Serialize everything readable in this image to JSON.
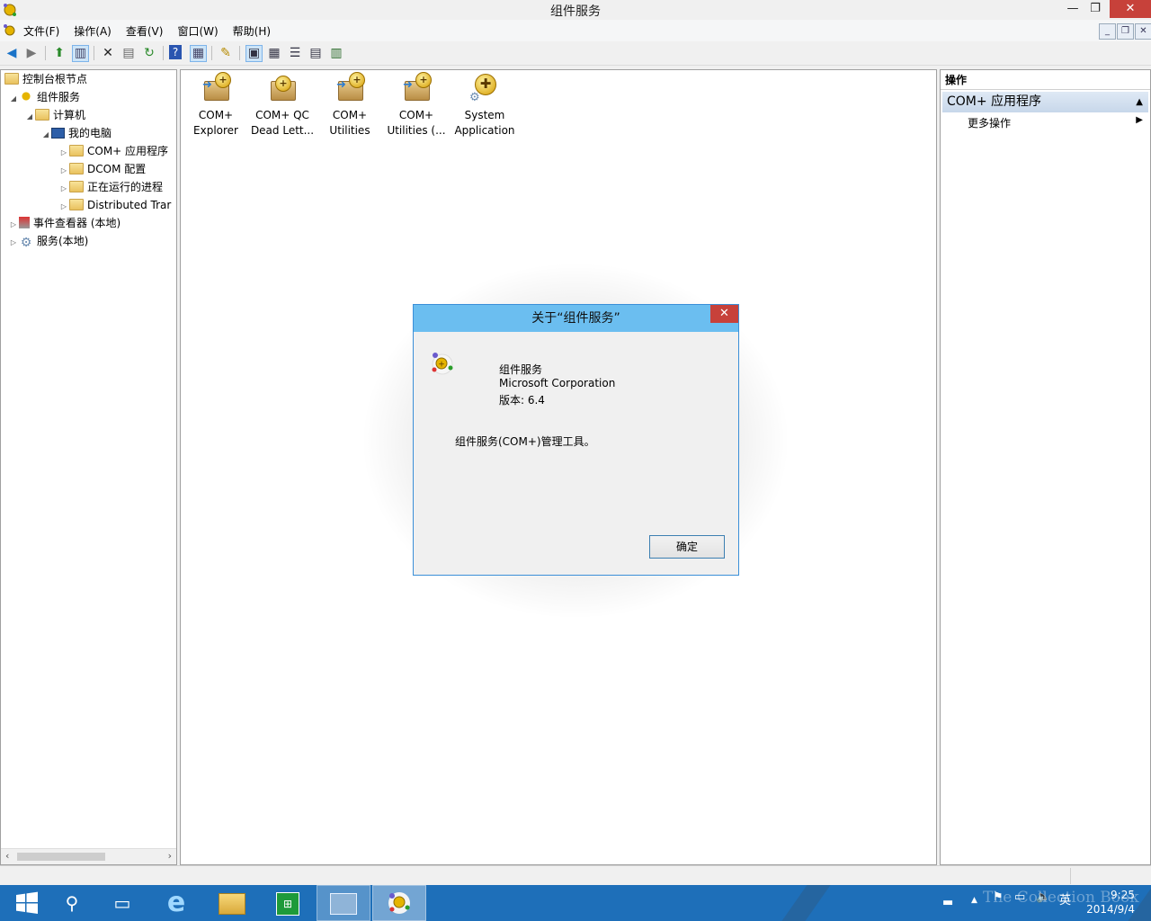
{
  "window": {
    "title": "组件服务",
    "minimize": "—",
    "maximize": "❐",
    "close": "✕"
  },
  "menu": {
    "items": [
      "文件(F)",
      "操作(A)",
      "查看(V)",
      "窗口(W)",
      "帮助(H)"
    ]
  },
  "tree": {
    "items": [
      {
        "label": "控制台根节点"
      },
      {
        "label": "组件服务"
      },
      {
        "label": "计算机"
      },
      {
        "label": "我的电脑"
      },
      {
        "label": "COM+ 应用程序"
      },
      {
        "label": "DCOM 配置"
      },
      {
        "label": "正在运行的进程"
      },
      {
        "label": "Distributed Trar"
      },
      {
        "label": "事件查看器 (本地)"
      },
      {
        "label": "服务(本地)"
      }
    ]
  },
  "center": {
    "items": [
      {
        "line1": "COM+",
        "line2": "Explorer"
      },
      {
        "line1": "COM+ QC",
        "line2": "Dead Lett..."
      },
      {
        "line1": "COM+",
        "line2": "Utilities"
      },
      {
        "line1": "COM+",
        "line2": "Utilities (..."
      },
      {
        "line1": "System",
        "line2": "Application"
      }
    ]
  },
  "actions": {
    "header": "操作",
    "section": "COM+ 应用程序",
    "item": "更多操作"
  },
  "dialog": {
    "title": "关于“组件服务”",
    "product": "组件服务",
    "company": "Microsoft Corporation",
    "version": "版本: 6.4",
    "description": "组件服务(COM+)管理工具。",
    "ok": "确定"
  },
  "taskbar": {
    "tray_lang": "英",
    "watermark": "The Collection Book",
    "time": "9:25",
    "date": "2014/9/4"
  },
  "colors": {
    "taskbar": "#1e6fb9",
    "dialog_title": "#6bbef0",
    "close_red": "#c7413a",
    "action_section": "#c7d7ea"
  }
}
